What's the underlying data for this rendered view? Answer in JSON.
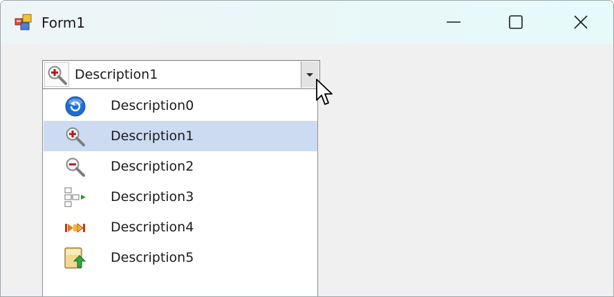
{
  "window": {
    "title": "Form1"
  },
  "combo": {
    "selected_text": "Description1",
    "selected_icon": "zoom-in-icon"
  },
  "dropdown": {
    "items": [
      {
        "label": "Description0",
        "icon": "refresh-back-icon"
      },
      {
        "label": "Description1",
        "icon": "zoom-in-icon",
        "selected": true
      },
      {
        "label": "Description2",
        "icon": "zoom-out-icon"
      },
      {
        "label": "Description3",
        "icon": "hierarchy-arrow-icon"
      },
      {
        "label": "Description4",
        "icon": "fast-forward-icon"
      },
      {
        "label": "Description5",
        "icon": "upload-folder-icon"
      }
    ]
  },
  "colors": {
    "selection": "#ccdbf2",
    "title_bar": "#e9f7f7",
    "client_area": "#f0f0f0"
  }
}
